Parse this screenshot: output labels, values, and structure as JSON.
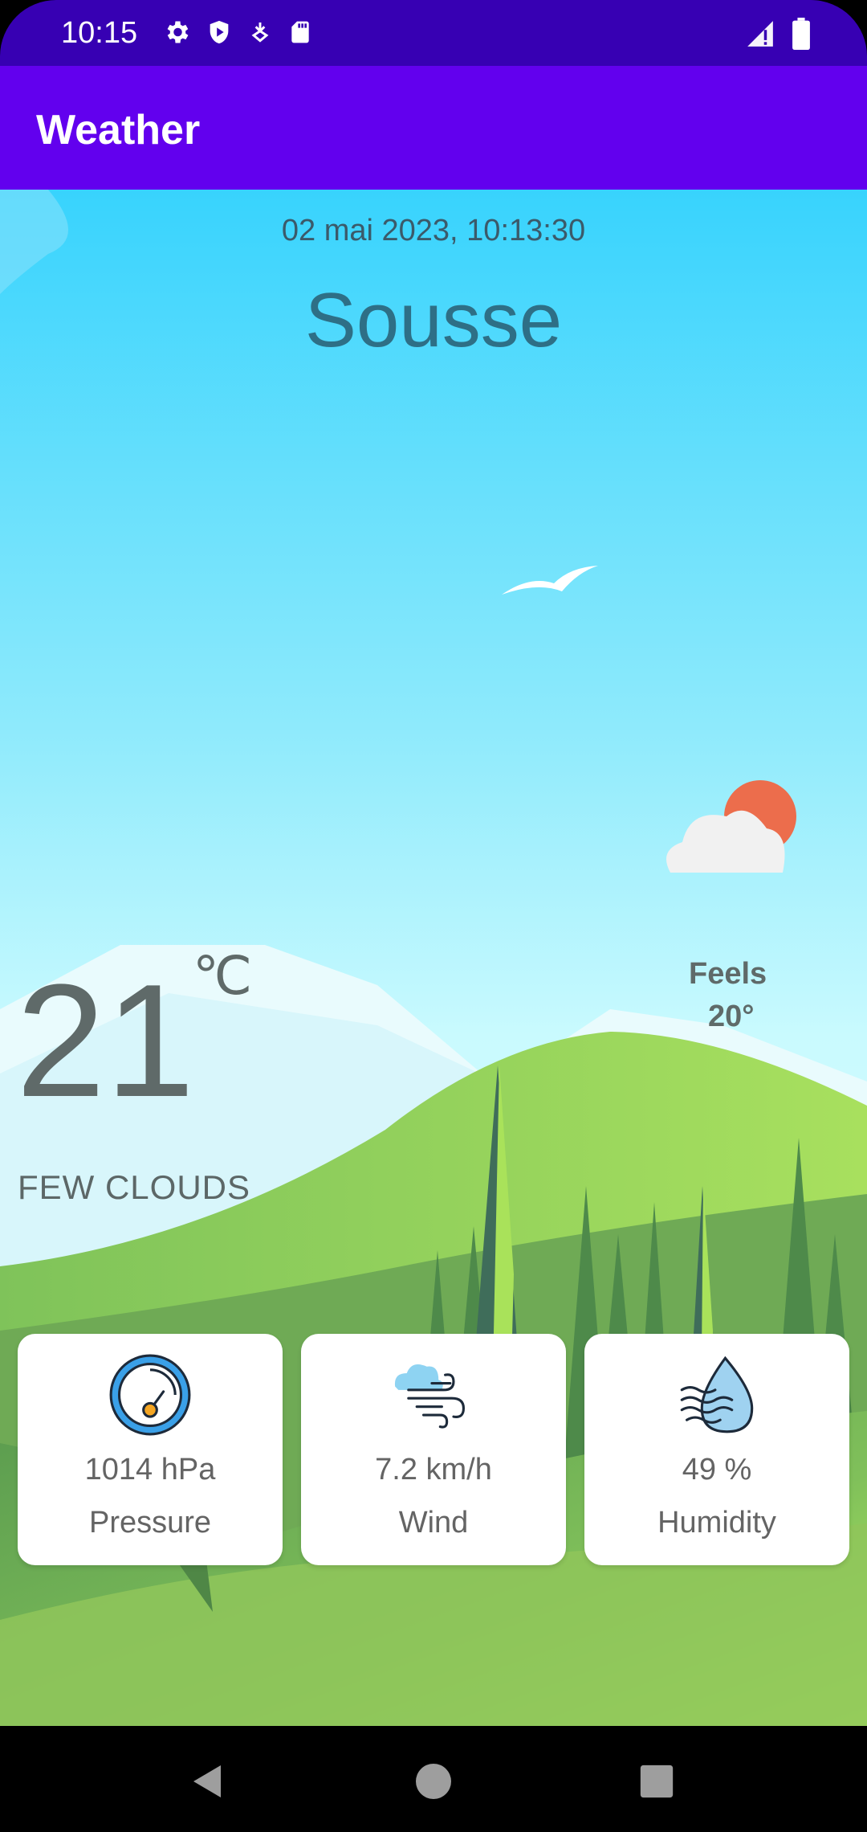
{
  "status_bar": {
    "time": "10:15",
    "left_icons": [
      "gear-icon",
      "shield-icon",
      "download-icon",
      "sd-card-icon"
    ],
    "right_icons": [
      "signal-icon",
      "battery-icon"
    ]
  },
  "app_bar": {
    "title": "Weather"
  },
  "weather": {
    "datetime": "02 mai 2023, 10:13:30",
    "city": "Sousse",
    "temperature": "21",
    "unit": "℃",
    "feels_label": "Feels",
    "feels_value": "20°",
    "description": "FEW CLOUDS",
    "condition_icon": "sun-behind-cloud-icon"
  },
  "cards": [
    {
      "value": "1014 hPa",
      "label": "Pressure",
      "icon": "barometer-icon"
    },
    {
      "value": "7.2 km/h",
      "label": "Wind",
      "icon": "wind-icon"
    },
    {
      "value": "49 %",
      "label": "Humidity",
      "icon": "humidity-drop-icon"
    }
  ],
  "nav_bar": {
    "buttons": [
      "back-icon",
      "home-icon",
      "recents-icon"
    ]
  },
  "colors": {
    "status_bar": "#3700b3",
    "app_bar": "#6200ee",
    "sky_top": "#38d3fd",
    "grass": "#7bbd54",
    "sun": "#ec6d4c"
  }
}
